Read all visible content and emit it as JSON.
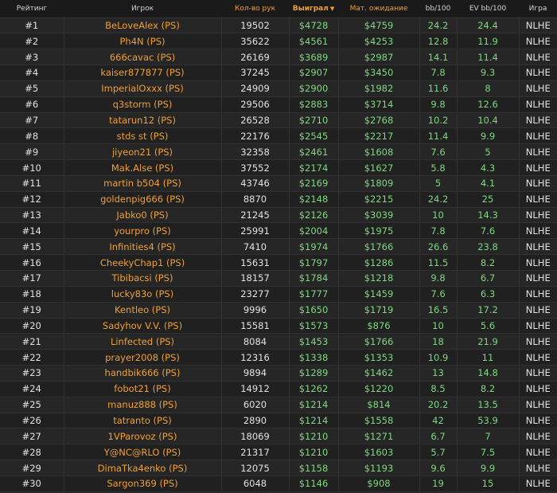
{
  "colors": {
    "accent": "#f0a030",
    "positive": "#7fd87f",
    "text": "#e2e2e2",
    "background": "#222222"
  },
  "header": {
    "rank": "Рейтинг",
    "player": "Игрок",
    "hands": "Кол-во рук",
    "won": "Выиграл",
    "ev": "Мат. ожидание",
    "bb100": "bb/100",
    "evbb100": "EV bb/100",
    "game": "Игра",
    "sort_icon": "caret-down-icon"
  },
  "rows": [
    {
      "rank": "#1",
      "player": "BeLoveAlex (PS)",
      "hands": "19502",
      "won": "$4728",
      "ev": "$4759",
      "bb100": "24.2",
      "evbb100": "24.4",
      "game": "NLHE"
    },
    {
      "rank": "#2",
      "player": "Ph4N (PS)",
      "hands": "35622",
      "won": "$4561",
      "ev": "$4253",
      "bb100": "12.8",
      "evbb100": "11.9",
      "game": "NLHE"
    },
    {
      "rank": "#3",
      "player": "666cavac (PS)",
      "hands": "26169",
      "won": "$3689",
      "ev": "$2987",
      "bb100": "14.1",
      "evbb100": "11.4",
      "game": "NLHE"
    },
    {
      "rank": "#4",
      "player": "kaiser877877 (PS)",
      "hands": "37245",
      "won": "$2907",
      "ev": "$3450",
      "bb100": "7.8",
      "evbb100": "9.3",
      "game": "NLHE"
    },
    {
      "rank": "#5",
      "player": "ImperialOxxx (PS)",
      "hands": "24909",
      "won": "$2900",
      "ev": "$1982",
      "bb100": "11.6",
      "evbb100": "8",
      "game": "NLHE"
    },
    {
      "rank": "#6",
      "player": "q3storm (PS)",
      "hands": "29506",
      "won": "$2883",
      "ev": "$3714",
      "bb100": "9.8",
      "evbb100": "12.6",
      "game": "NLHE"
    },
    {
      "rank": "#7",
      "player": "tatarun12 (PS)",
      "hands": "26528",
      "won": "$2710",
      "ev": "$2768",
      "bb100": "10.2",
      "evbb100": "10.4",
      "game": "NLHE"
    },
    {
      "rank": "#8",
      "player": "stds st (PS)",
      "hands": "22176",
      "won": "$2545",
      "ev": "$2217",
      "bb100": "11.4",
      "evbb100": "9.9",
      "game": "NLHE"
    },
    {
      "rank": "#9",
      "player": "jiyeon21 (PS)",
      "hands": "32358",
      "won": "$2461",
      "ev": "$1608",
      "bb100": "7.6",
      "evbb100": "5",
      "game": "NLHE"
    },
    {
      "rank": "#10",
      "player": "Mak.Alse (PS)",
      "hands": "37552",
      "won": "$2174",
      "ev": "$1627",
      "bb100": "5.8",
      "evbb100": "4.3",
      "game": "NLHE"
    },
    {
      "rank": "#11",
      "player": "martin b504 (PS)",
      "hands": "43746",
      "won": "$2169",
      "ev": "$1809",
      "bb100": "5",
      "evbb100": "4.1",
      "game": "NLHE"
    },
    {
      "rank": "#12",
      "player": "goldenpig666 (PS)",
      "hands": "8870",
      "won": "$2148",
      "ev": "$2215",
      "bb100": "24.2",
      "evbb100": "25",
      "game": "NLHE"
    },
    {
      "rank": "#13",
      "player": "Jabko0 (PS)",
      "hands": "21245",
      "won": "$2126",
      "ev": "$3039",
      "bb100": "10",
      "evbb100": "14.3",
      "game": "NLHE"
    },
    {
      "rank": "#14",
      "player": "yourpro (PS)",
      "hands": "25991",
      "won": "$2004",
      "ev": "$1975",
      "bb100": "7.8",
      "evbb100": "7.6",
      "game": "NLHE"
    },
    {
      "rank": "#15",
      "player": "Infinities4 (PS)",
      "hands": "7410",
      "won": "$1974",
      "ev": "$1766",
      "bb100": "26.6",
      "evbb100": "23.8",
      "game": "NLHE"
    },
    {
      "rank": "#16",
      "player": "CheekyChap1 (PS)",
      "hands": "15631",
      "won": "$1797",
      "ev": "$1286",
      "bb100": "11.5",
      "evbb100": "8.2",
      "game": "NLHE"
    },
    {
      "rank": "#17",
      "player": "Tibibacsi (PS)",
      "hands": "18157",
      "won": "$1784",
      "ev": "$1218",
      "bb100": "9.8",
      "evbb100": "6.7",
      "game": "NLHE"
    },
    {
      "rank": "#18",
      "player": "lucky83o (PS)",
      "hands": "23277",
      "won": "$1777",
      "ev": "$1459",
      "bb100": "7.6",
      "evbb100": "6.3",
      "game": "NLHE"
    },
    {
      "rank": "#19",
      "player": "Kentleo (PS)",
      "hands": "9996",
      "won": "$1650",
      "ev": "$1719",
      "bb100": "16.5",
      "evbb100": "17.2",
      "game": "NLHE"
    },
    {
      "rank": "#20",
      "player": "Sadyhov V.V. (PS)",
      "hands": "15581",
      "won": "$1573",
      "ev": "$876",
      "bb100": "10",
      "evbb100": "5.6",
      "game": "NLHE"
    },
    {
      "rank": "#21",
      "player": "Linfected (PS)",
      "hands": "8084",
      "won": "$1453",
      "ev": "$1766",
      "bb100": "18",
      "evbb100": "21.9",
      "game": "NLHE"
    },
    {
      "rank": "#22",
      "player": "prayer2008 (PS)",
      "hands": "12316",
      "won": "$1338",
      "ev": "$1353",
      "bb100": "10.9",
      "evbb100": "11",
      "game": "NLHE"
    },
    {
      "rank": "#23",
      "player": "handbik666 (PS)",
      "hands": "9894",
      "won": "$1289",
      "ev": "$1462",
      "bb100": "13",
      "evbb100": "14.8",
      "game": "NLHE"
    },
    {
      "rank": "#24",
      "player": "fobot21 (PS)",
      "hands": "14912",
      "won": "$1262",
      "ev": "$1220",
      "bb100": "8.5",
      "evbb100": "8.2",
      "game": "NLHE"
    },
    {
      "rank": "#25",
      "player": "manuz888 (PS)",
      "hands": "6020",
      "won": "$1214",
      "ev": "$814",
      "bb100": "20.2",
      "evbb100": "13.5",
      "game": "NLHE"
    },
    {
      "rank": "#26",
      "player": "tatranto (PS)",
      "hands": "2890",
      "won": "$1214",
      "ev": "$1558",
      "bb100": "42",
      "evbb100": "53.9",
      "game": "NLHE"
    },
    {
      "rank": "#27",
      "player": "1VParovoz (PS)",
      "hands": "18069",
      "won": "$1210",
      "ev": "$1271",
      "bb100": "6.7",
      "evbb100": "7",
      "game": "NLHE"
    },
    {
      "rank": "#28",
      "player": "Y@NC@RLO (PS)",
      "hands": "21317",
      "won": "$1210",
      "ev": "$1603",
      "bb100": "5.7",
      "evbb100": "7.5",
      "game": "NLHE"
    },
    {
      "rank": "#29",
      "player": "DimaTka4enko (PS)",
      "hands": "12075",
      "won": "$1158",
      "ev": "$1193",
      "bb100": "9.6",
      "evbb100": "9.9",
      "game": "NLHE"
    },
    {
      "rank": "#30",
      "player": "Sargon369 (PS)",
      "hands": "6048",
      "won": "$1146",
      "ev": "$908",
      "bb100": "19",
      "evbb100": "15",
      "game": "NLHE"
    }
  ]
}
